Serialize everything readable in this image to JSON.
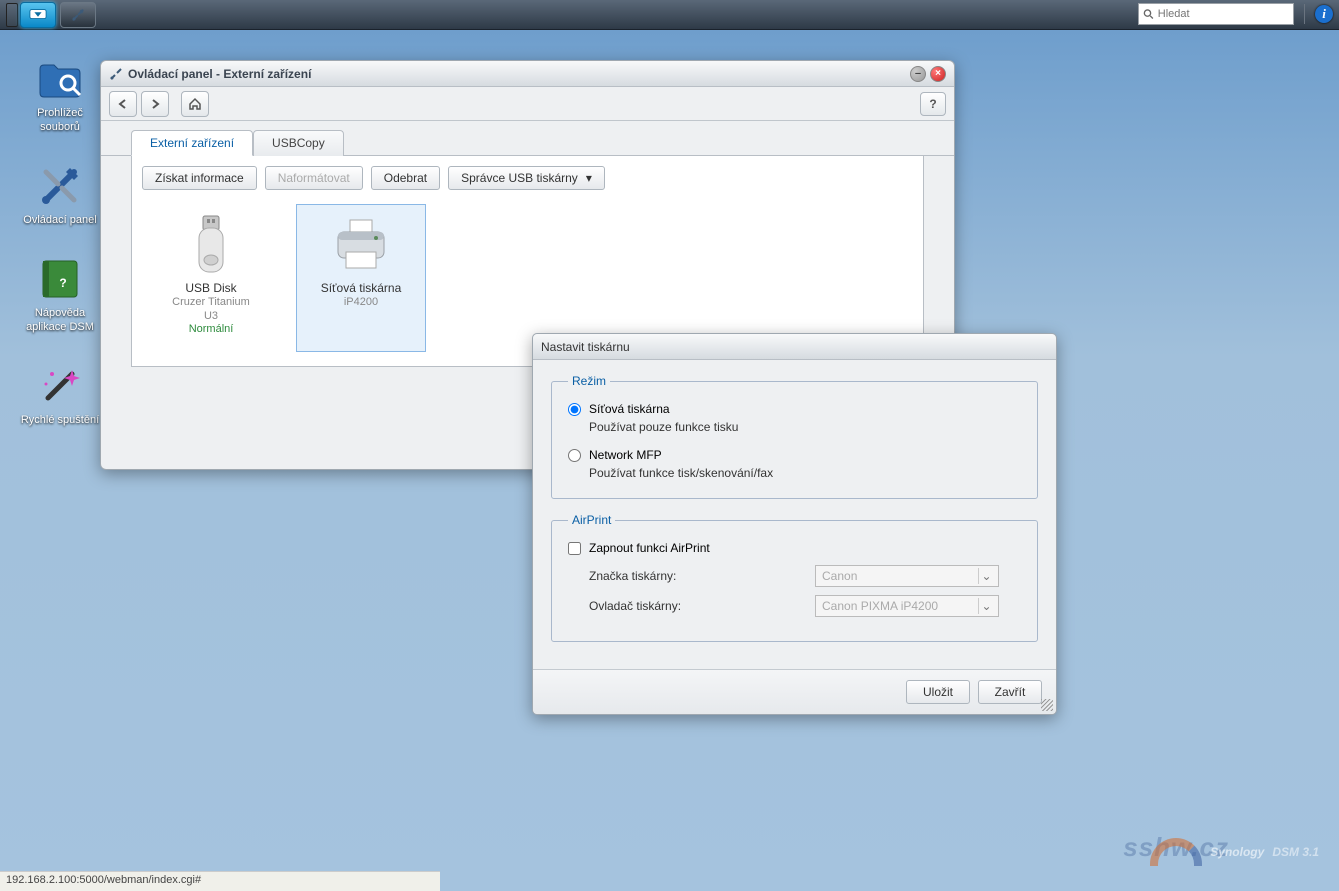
{
  "taskbar": {
    "search_placeholder": "Hledat"
  },
  "desktop": {
    "items": [
      {
        "label": "Prohlížeč souborů"
      },
      {
        "label": "Ovládací panel"
      },
      {
        "label": "Nápověda aplikace DSM"
      },
      {
        "label": "Rychlé spuštění"
      }
    ]
  },
  "window": {
    "title": "Ovládací panel - Externí zařízení",
    "tabs": [
      {
        "label": "Externí zařízení",
        "active": true
      },
      {
        "label": "USBCopy"
      }
    ],
    "actions": {
      "info": "Získat informace",
      "format": "Naformátovat",
      "remove": "Odebrat",
      "usb_mgr": "Správce USB tiskárny"
    },
    "devices": [
      {
        "name": "USB Disk",
        "sub1": "Cruzer Titanium",
        "sub2": "U3",
        "status": "Normální"
      },
      {
        "name": "Síťová tiskárna",
        "sub1": "iP4200"
      }
    ]
  },
  "dialog": {
    "title": "Nastavit tiskárnu",
    "mode": {
      "legend": "Režim",
      "opt1": "Síťová tiskárna",
      "opt1_desc": "Používat pouze funkce tisku",
      "opt2": "Network MFP",
      "opt2_desc": "Používat funkce tisk/skenování/fax"
    },
    "airprint": {
      "legend": "AirPrint",
      "enable": "Zapnout funkci AirPrint",
      "brand_label": "Značka tiskárny:",
      "brand_value": "Canon",
      "driver_label": "Ovladač tiskárny:",
      "driver_value": "Canon PIXMA iP4200"
    },
    "save": "Uložit",
    "close": "Zavřít"
  },
  "branding": {
    "syno": "Synology",
    "dsm": "DSM 3.1",
    "overlay": "sshw.cz"
  },
  "statusbar": "192.168.2.100:5000/webman/index.cgi#"
}
